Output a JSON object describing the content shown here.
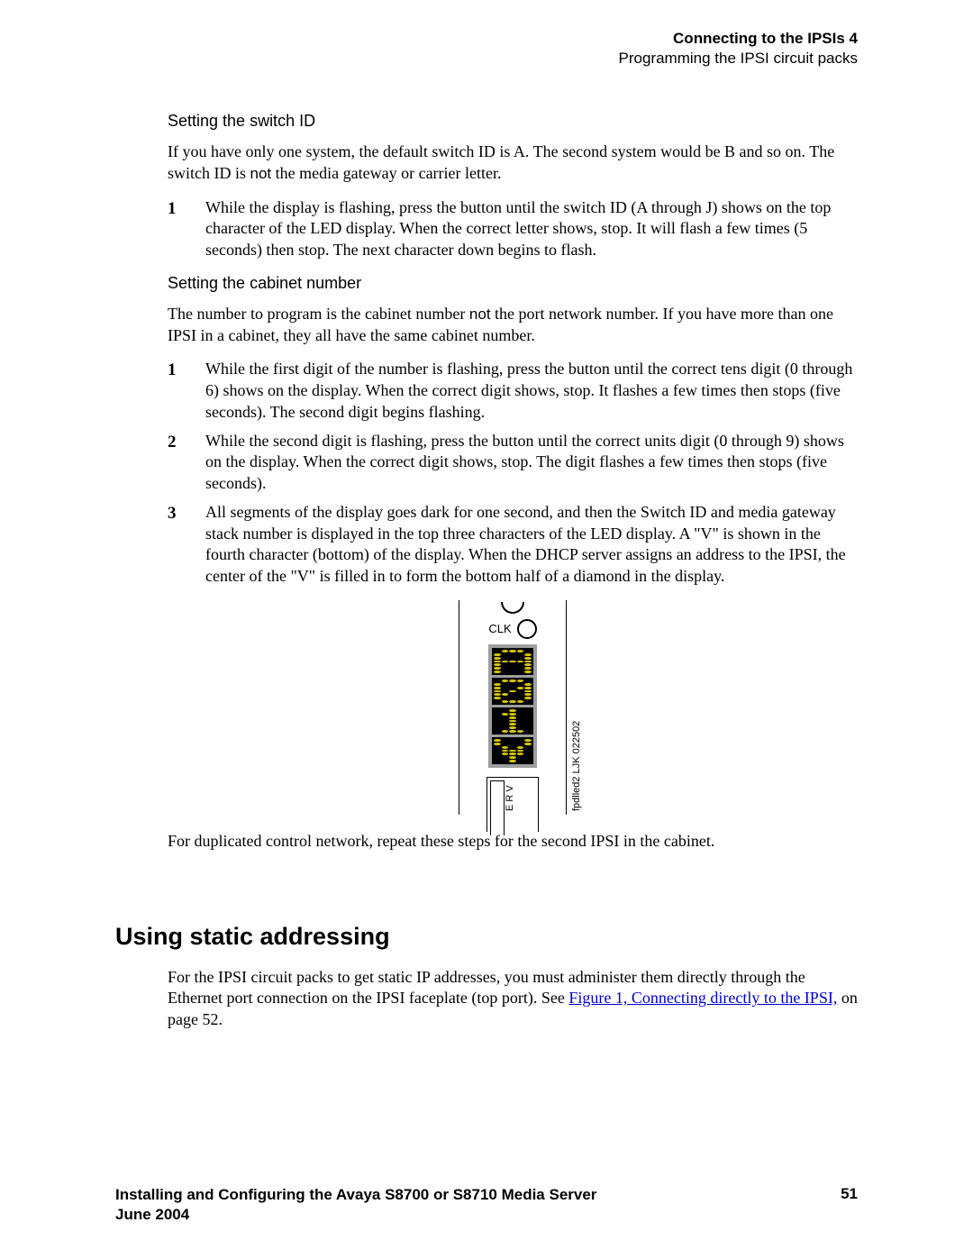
{
  "header": {
    "chapter": "Connecting to the IPSIs 4",
    "section": "Programming the IPSI circuit packs"
  },
  "section1": {
    "heading": "Setting the switch ID",
    "intro_pre": "If you have only one system, the default switch ID is A. The second system would be B and so on. The switch ID is ",
    "intro_not": "not",
    "intro_post": " the media gateway or carrier letter.",
    "steps": [
      {
        "n": "1",
        "text": "While the display is flashing, press the button until the switch ID (A through J) shows on the top character of the LED display. When the correct letter shows, stop. It will flash a few times (5 seconds) then stop. The next character down begins to flash."
      }
    ]
  },
  "section2": {
    "heading": "Setting the cabinet number",
    "intro_pre": "The number to program is the cabinet number ",
    "intro_not": "not",
    "intro_post": " the port network number. If you have more than one IPSI in a cabinet, they all have the same cabinet number.",
    "steps": [
      {
        "n": "1",
        "text": "While the first digit of the number is flashing, press the button until the correct tens digit (0 through 6) shows on the display. When the correct digit shows, stop. It flashes a few times then stops (five seconds). The second digit begins flashing."
      },
      {
        "n": "2",
        "text": "While the second digit is flashing, press the button until the correct units digit (0 through 9) shows on the display. When the correct digit shows, stop. The digit flashes a few times then stops (five seconds)."
      },
      {
        "n": "3",
        "text": "All segments of the display goes dark for one second, and then the Switch ID and media gateway stack number is displayed in the top three characters of the LED display. A \"V\" is shown in the fourth character (bottom) of the display. When the DHCP server assigns an address to the IPSI, the center of the \"V\" is filled in to form the bottom half of a diamond in the display."
      }
    ]
  },
  "figure": {
    "clk_label": "CLK",
    "chars": [
      "A",
      "0",
      "1",
      "V_filled"
    ],
    "inner_label": "E R V",
    "code": "fpdlled2 LJK 022502"
  },
  "after_figure": "For duplicated control network, repeat these steps for the second IPSI in the cabinet.",
  "section3": {
    "heading": "Using static addressing",
    "para_pre": "For the IPSI circuit packs to get static IP addresses, you must administer them directly through the Ethernet port connection on the IPSI faceplate (top port). See ",
    "link": "Figure 1, Connecting directly to the IPSI,",
    "para_post": " on page 52."
  },
  "footer": {
    "title": "Installing and Configuring the Avaya S8700 or S8710 Media Server",
    "date": "June 2004",
    "page": "51"
  }
}
